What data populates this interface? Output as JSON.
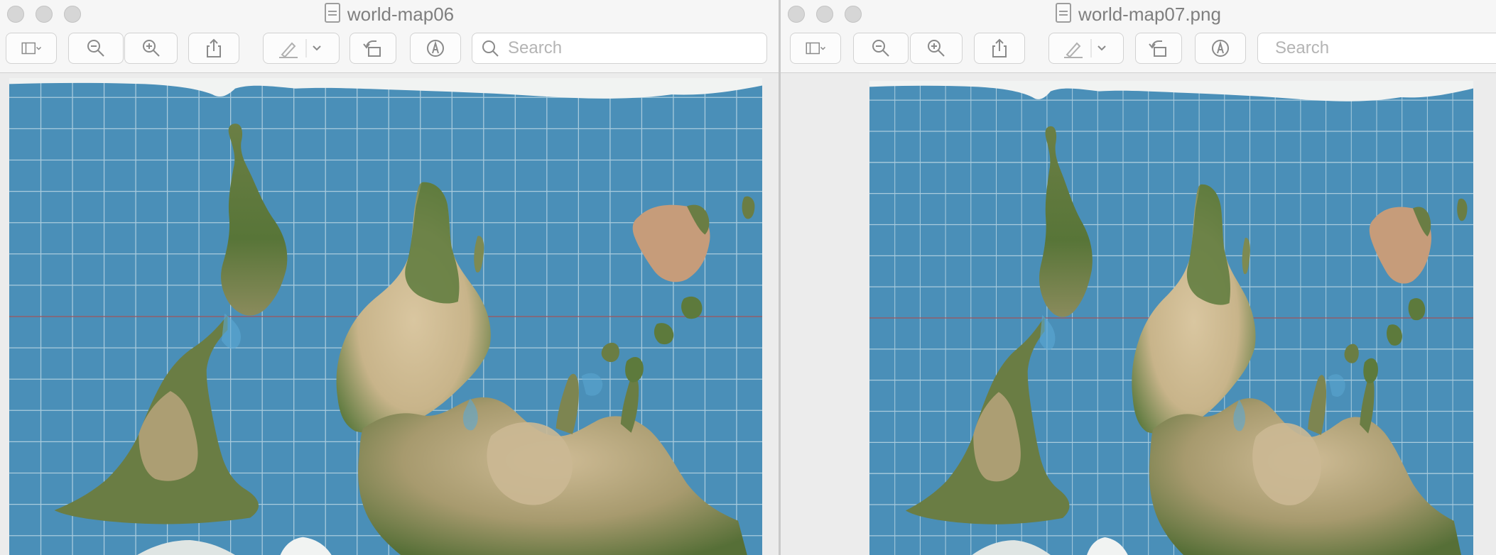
{
  "windows": [
    {
      "title": "world-map06",
      "search_placeholder": "Search",
      "image_alt": "World map, south-up orientation"
    },
    {
      "title": "world-map07.png",
      "search_placeholder": "Search",
      "image_alt": "World map, south-up orientation"
    }
  ],
  "icons": {
    "window_controls": [
      "close-icon",
      "minimize-icon",
      "zoom-icon"
    ],
    "toolbar": [
      "sidebar-icon",
      "zoom-out-icon",
      "zoom-in-icon",
      "share-icon",
      "markup-pen-icon",
      "rotate-icon",
      "annotate-icon",
      "search-icon"
    ]
  },
  "colors": {
    "ocean": "#4a8fb8",
    "grid": "#c9dfea",
    "equator": "#a0545c",
    "ice": "#f4f6f5",
    "forest": "#5e7a3e",
    "desert": "#cdb791",
    "toolbar_bg": "#f6f6f6",
    "window_bg": "#ececec"
  }
}
